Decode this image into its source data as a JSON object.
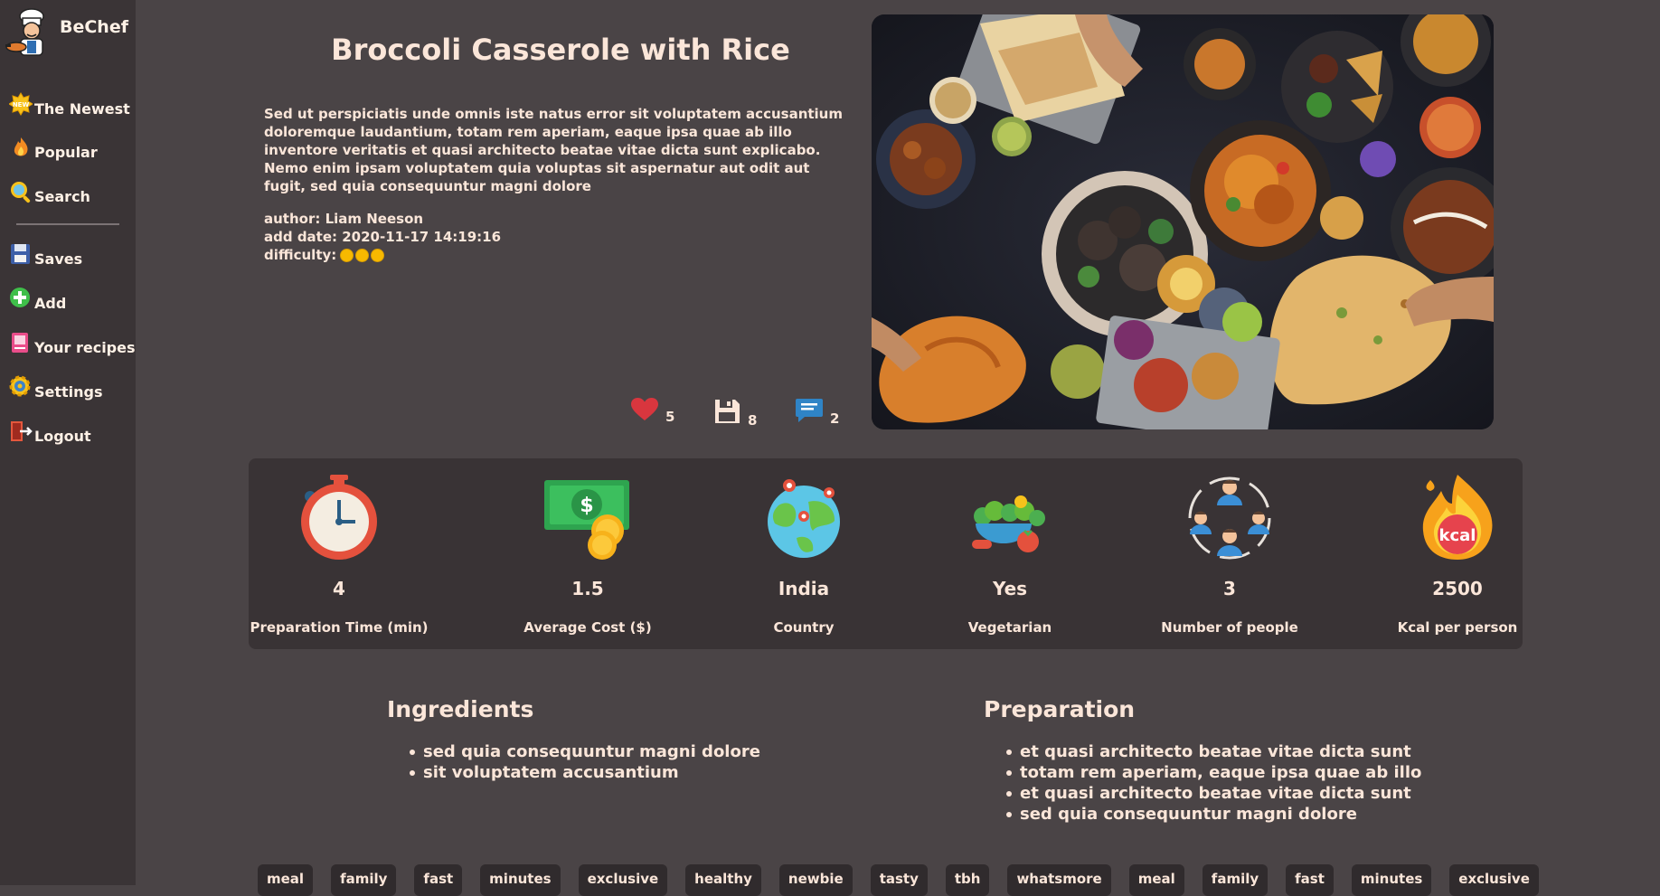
{
  "app": {
    "name": "BeChef"
  },
  "nav": {
    "newest": "The Newest",
    "popular": "Popular",
    "search": "Search",
    "saves": "Saves",
    "add": "Add",
    "your_recipes": "Your recipes",
    "settings": "Settings",
    "logout": "Logout"
  },
  "recipe": {
    "title": "Broccoli Casserole with Rice",
    "description": "Sed ut perspiciatis unde omnis iste natus error sit voluptatem accusantium doloremque laudantium, totam rem aperiam, eaque ipsa quae ab illo inventore veritatis et quasi architecto beatae vitae dicta sunt explicabo. Nemo enim ipsam voluptatem quia voluptas sit aspernatur aut odit aut fugit, sed quia consequuntur magni dolore",
    "author": "author: Liam Neeson",
    "add_date": "add date: 2020-11-17 14:19:16",
    "difficulty_label": "difficulty:",
    "difficulty_level": 3
  },
  "stats": {
    "likes": "5",
    "saves": "8",
    "comments": "2"
  },
  "info": {
    "prep_time": {
      "value": "4",
      "label": "Preparation Time (min)"
    },
    "cost": {
      "value": "1.5",
      "label": "Average Cost ($)"
    },
    "country": {
      "value": "India",
      "label": "Country"
    },
    "vegetarian": {
      "value": "Yes",
      "label": "Vegetarian"
    },
    "people": {
      "value": "3",
      "label": "Number of people"
    },
    "kcal": {
      "value": "2500",
      "label": "Kcal per person",
      "badge": "kcal"
    }
  },
  "ingredients": {
    "title": "Ingredients",
    "items": [
      "sed quia consequuntur magni dolore",
      "sit voluptatem accusantium"
    ]
  },
  "preparation": {
    "title": "Preparation",
    "items": [
      "et quasi architecto beatae vitae dicta sunt",
      "totam rem aperiam, eaque ipsa quae ab illo",
      "et quasi architecto beatae vitae dicta sunt",
      "sed quia consequuntur magni dolore"
    ]
  },
  "tags": [
    "meal",
    "family",
    "fast",
    "minutes",
    "exclusive",
    "healthy",
    "newbie",
    "tasty",
    "tbh",
    "whatsmore",
    "meal",
    "family",
    "fast",
    "minutes",
    "exclusive"
  ],
  "icons": {
    "newest": "new-badge-icon",
    "popular": "flame-icon",
    "search": "magnifier-icon",
    "saves": "floppy-icon",
    "add": "plus-circle-icon",
    "your_recipes": "recipe-book-icon",
    "settings": "gear-icon",
    "logout": "exit-door-icon"
  },
  "colors": {
    "background": "#4a4446",
    "sidebar": "#3a3436",
    "panel": "#393335",
    "text": "#fbe6d9",
    "heart": "#d9363e",
    "comment": "#2f84c6",
    "difficulty": "#f7b900"
  }
}
